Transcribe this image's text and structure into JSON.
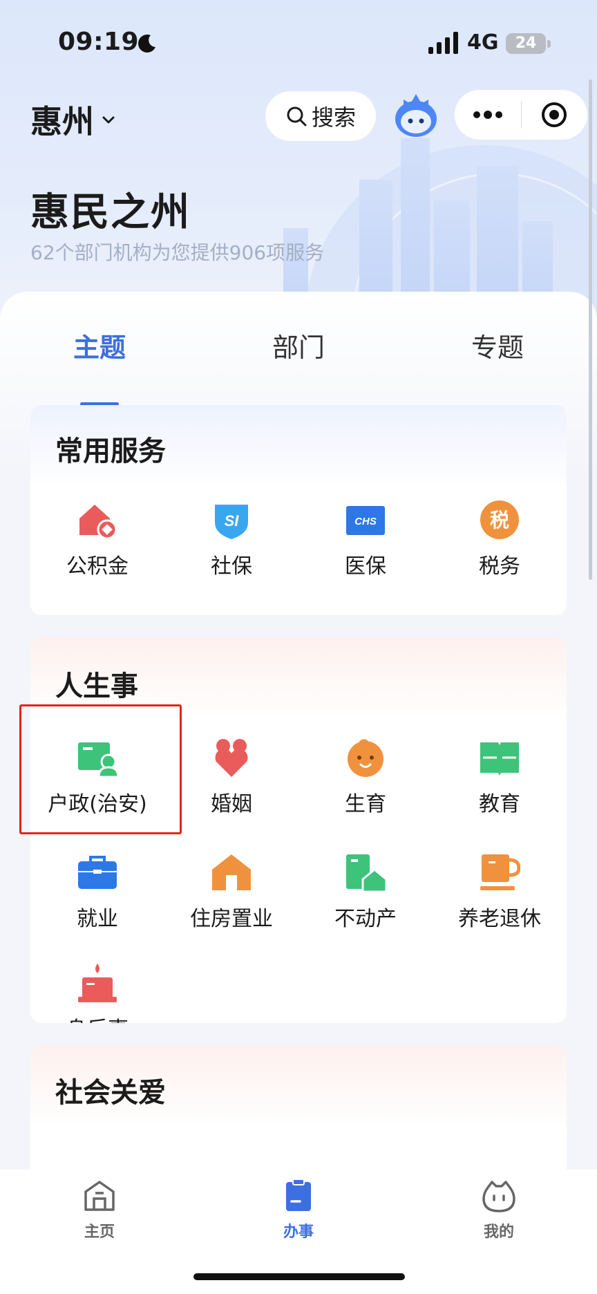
{
  "status_bar": {
    "time": "09:19",
    "network": "4G",
    "battery": "24"
  },
  "header": {
    "city": "惠州",
    "search_label": "搜索"
  },
  "hero": {
    "title": "惠民之州",
    "subtitle": "62个部门机构为您提供906项服务"
  },
  "tabs": [
    {
      "label": "主题",
      "active": true
    },
    {
      "label": "部门",
      "active": false
    },
    {
      "label": "专题",
      "active": false
    }
  ],
  "common_services": {
    "title": "常用服务",
    "items": [
      {
        "label": "公积金",
        "icon": "housing-fund-icon"
      },
      {
        "label": "社保",
        "icon": "social-security-icon",
        "icon_text": "SI"
      },
      {
        "label": "医保",
        "icon": "medical-insurance-icon",
        "icon_text": "CHS"
      },
      {
        "label": "税务",
        "icon": "tax-icon",
        "icon_text": "税"
      }
    ]
  },
  "life_events": {
    "title": "人生事",
    "items": [
      {
        "label": "户政(治安)",
        "icon": "household-registration-icon"
      },
      {
        "label": "婚姻",
        "icon": "marriage-icon"
      },
      {
        "label": "生育",
        "icon": "baby-icon"
      },
      {
        "label": "教育",
        "icon": "book-icon"
      },
      {
        "label": "就业",
        "icon": "briefcase-icon"
      },
      {
        "label": "住房置业",
        "icon": "house-icon"
      },
      {
        "label": "不动产",
        "icon": "real-estate-icon"
      },
      {
        "label": "养老退休",
        "icon": "teacup-icon"
      },
      {
        "label": "身后事",
        "icon": "candle-icon"
      }
    ]
  },
  "social_care": {
    "title": "社会关爱"
  },
  "bottom_nav": [
    {
      "label": "主页",
      "icon": "home-icon",
      "active": false
    },
    {
      "label": "办事",
      "icon": "clipboard-icon",
      "active": true
    },
    {
      "label": "我的",
      "icon": "profile-icon",
      "active": false
    }
  ],
  "colors": {
    "accent": "#3c6fe0",
    "highlight_box": "#e2231a"
  }
}
